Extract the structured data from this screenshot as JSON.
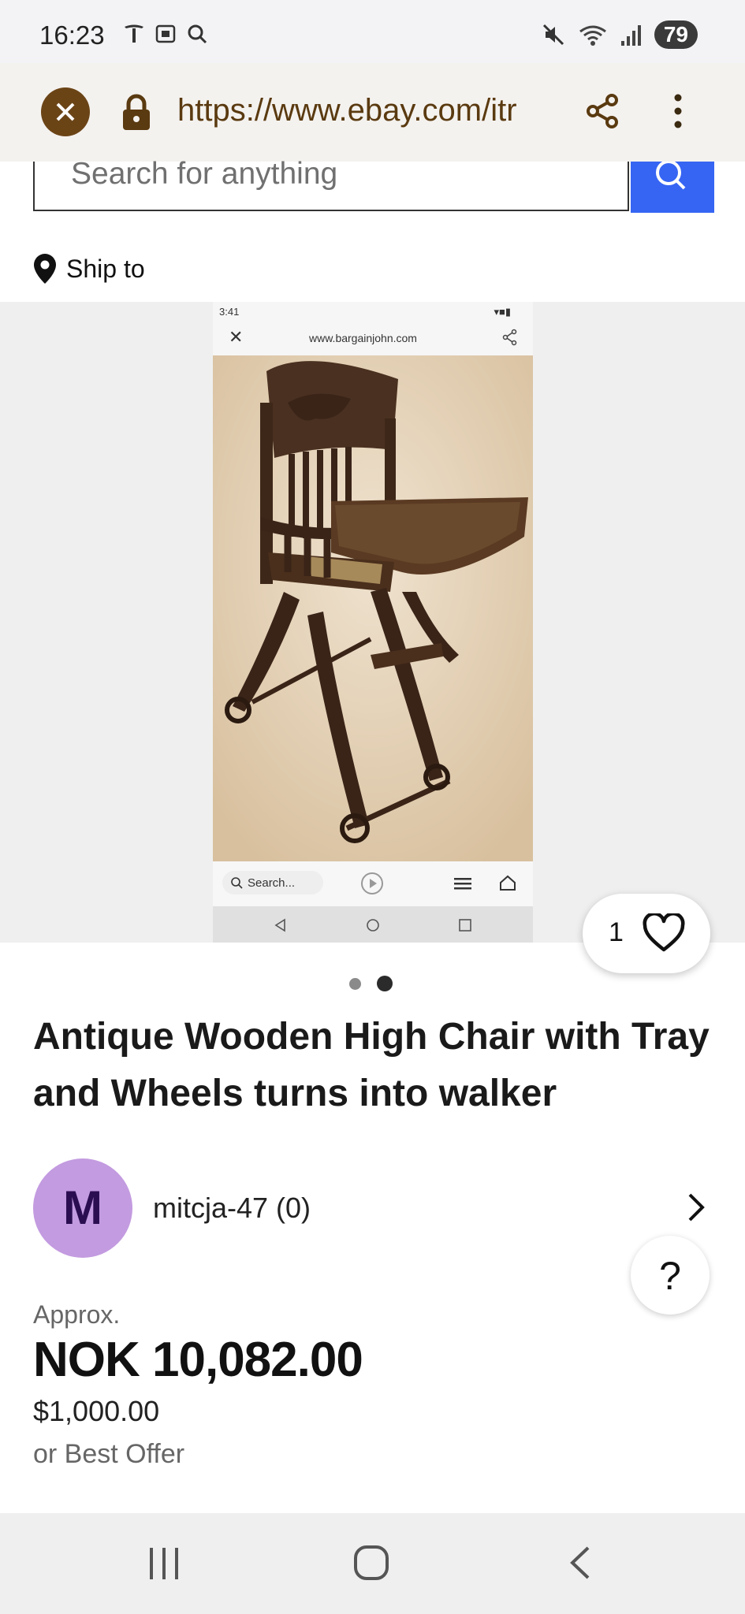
{
  "status_bar": {
    "time": "16:23",
    "battery": "79",
    "icons": [
      "tesla-icon",
      "screenshot-icon",
      "search-icon",
      "mute-icon",
      "wifi-icon",
      "signal-icon"
    ]
  },
  "browser": {
    "url": "https://www.ebay.com/itr",
    "accent_color": "#6b4416"
  },
  "search": {
    "placeholder": "Search for anything",
    "button_color": "#3665f3"
  },
  "ship_to": {
    "label": "Ship to"
  },
  "gallery": {
    "embedded_screenshot": {
      "time": "3:41",
      "url": "www.bargainjohn.com",
      "search_placeholder": "Search..."
    },
    "watch_count": "1",
    "page_count": 2,
    "active_page": 2
  },
  "listing": {
    "title": "Antique Wooden High Chair with Tray and Wheels turns into walker",
    "seller": {
      "initial": "M",
      "name": "mitcja-47 (0)",
      "avatar_color": "#c39be0"
    },
    "help_label": "?",
    "approx_label": "Approx.",
    "price": "NOK 10,082.00",
    "price_usd": "$1,000.00",
    "offer_text": "or Best Offer"
  },
  "nav_bar": {
    "buttons": [
      "recent-apps-icon",
      "home-icon",
      "back-icon"
    ]
  }
}
